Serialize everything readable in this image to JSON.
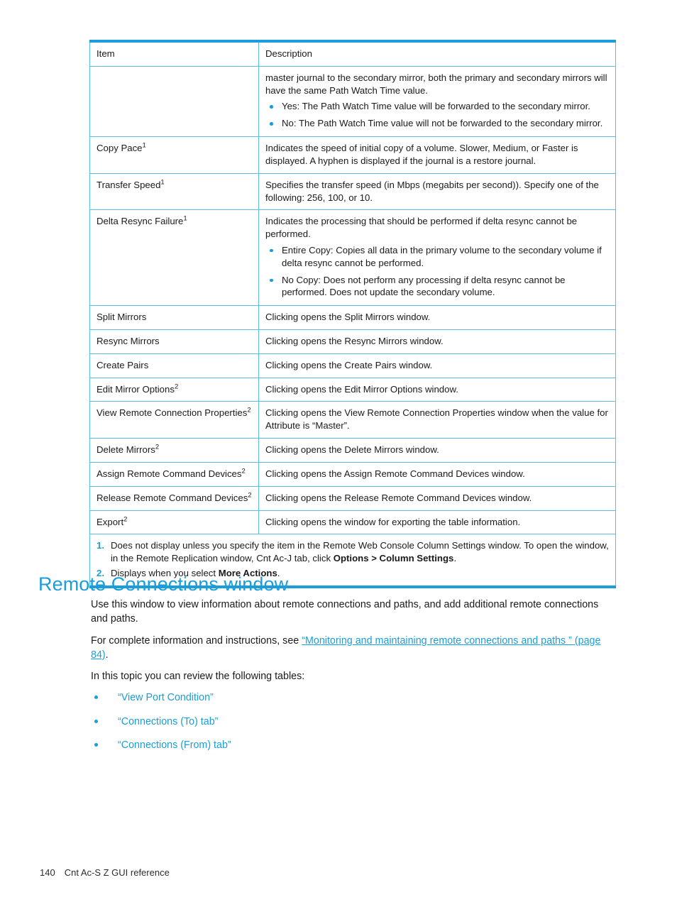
{
  "colors": {
    "accent": "#1b9dd9",
    "rule_light": "#5bbde8",
    "text": "#1a1a1a"
  },
  "table": {
    "headers": {
      "item": "Item",
      "description": "Description"
    },
    "rows": [
      {
        "item": "",
        "desc_paragraphs": [
          "master journal to the secondary mirror, both the primary and secondary mirrors will have the same Path Watch Time value."
        ],
        "desc_bullets": [
          "Yes: The Path Watch Time value will be forwarded to the secondary mirror.",
          "No: The Path Watch Time value will not be forwarded to the secondary mirror."
        ]
      },
      {
        "item": "Copy Pace",
        "item_sup": "1",
        "desc_paragraphs": [
          "Indicates the speed of initial copy of a volume. Slower, Medium, or Faster is displayed. A hyphen is displayed if the journal is a restore journal."
        ],
        "desc_bullets": []
      },
      {
        "item": "Transfer Speed",
        "item_sup": "1",
        "desc_paragraphs": [
          "Specifies the transfer speed (in Mbps (megabits per second)). Specify one of the following: 256, 100, or 10."
        ],
        "desc_bullets": []
      },
      {
        "item": "Delta Resync Failure",
        "item_sup": "1",
        "desc_paragraphs": [
          "Indicates the processing that should be performed if delta resync cannot be performed."
        ],
        "desc_bullets": [
          "Entire Copy: Copies all data in the primary volume to the secondary volume if delta resync cannot be performed.",
          "No Copy: Does not perform any processing if delta resync cannot be performed. Does not update the secondary volume."
        ]
      },
      {
        "item": "Split Mirrors",
        "item_sup": "",
        "desc_paragraphs": [
          "Clicking opens the Split Mirrors window."
        ],
        "desc_bullets": []
      },
      {
        "item": "Resync Mirrors",
        "item_sup": "",
        "desc_paragraphs": [
          "Clicking opens the Resync Mirrors window."
        ],
        "desc_bullets": []
      },
      {
        "item": "Create Pairs",
        "item_sup": "",
        "desc_paragraphs": [
          "Clicking opens the Create Pairs window."
        ],
        "desc_bullets": []
      },
      {
        "item": "Edit Mirror Options",
        "item_sup": "2",
        "desc_paragraphs": [
          "Clicking opens the Edit Mirror Options window."
        ],
        "desc_bullets": []
      },
      {
        "item": "View Remote Connection Properties",
        "item_sup": "2",
        "desc_paragraphs": [
          "Clicking opens the View Remote Connection Properties window when the value for Attribute is “Master”."
        ],
        "desc_bullets": []
      },
      {
        "item": "Delete Mirrors",
        "item_sup": "2",
        "desc_paragraphs": [
          "Clicking opens the Delete Mirrors window."
        ],
        "desc_bullets": []
      },
      {
        "item": "Assign Remote Command Devices",
        "item_sup": "2",
        "desc_paragraphs": [
          "Clicking opens the Assign Remote Command Devices window."
        ],
        "desc_bullets": []
      },
      {
        "item": "Release Remote Command Devices",
        "item_sup": "2",
        "desc_paragraphs": [
          "Clicking opens the Release Remote Command Devices window."
        ],
        "desc_bullets": []
      },
      {
        "item": "Export",
        "item_sup": "2",
        "desc_paragraphs": [
          "Clicking opens the window for exporting the table information."
        ],
        "desc_bullets": []
      }
    ],
    "footnotes": [
      {
        "num": "1.",
        "part1": "Does not display unless you specify the item in the Remote Web Console Column Settings window. To open the window, in the Remote Replication window, Cnt Ac-J tab, click ",
        "bold": "Options > Column Settings",
        "part2": "."
      },
      {
        "num": "2.",
        "part1": "Displays when you select ",
        "bold": "More Actions",
        "part2": "."
      }
    ]
  },
  "section": {
    "heading": "Remote Connections window",
    "paragraph1": "Use this window to view information about remote connections and paths, and add additional remote connections and paths.",
    "paragraph2_pre": "For complete information and instructions, see ",
    "paragraph2_link": "“Monitoring and maintaining remote connections and paths ” (page 84)",
    "paragraph2_post": ".",
    "paragraph3": "In this topic you can review the following tables:",
    "links": [
      "“View Port Condition”",
      "“Connections (To) tab”",
      "“Connections (From) tab”"
    ]
  },
  "footer": {
    "page_number": "140",
    "title": "Cnt Ac-S Z GUI reference"
  }
}
